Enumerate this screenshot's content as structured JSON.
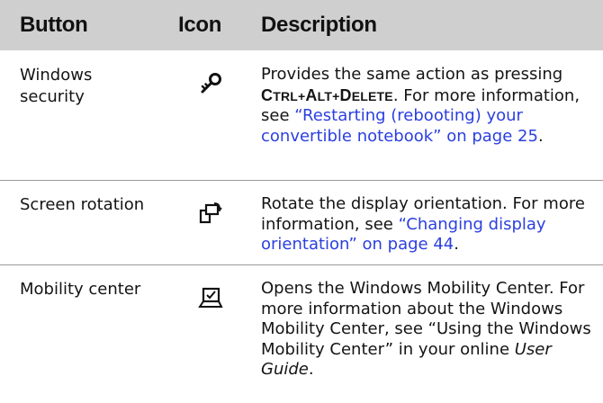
{
  "headers": {
    "button": "Button",
    "icon": "Icon",
    "description": "Description"
  },
  "rows": [
    {
      "button": "Windows security",
      "icon": "key-icon",
      "desc": {
        "pre": "Provides the same action as pressing ",
        "keys": [
          "Ctrl",
          "+",
          "Alt",
          "+",
          "Delete"
        ],
        "mid": ". For more information, see ",
        "link": "“Restarting (rebooting) your convertible notebook” on page 25",
        "post": "."
      }
    },
    {
      "button": "Screen rotation",
      "icon": "screen-rotation-icon",
      "desc": {
        "pre": "Rotate the display orientation. For more information, see ",
        "link": "“Changing display orientation” on page 44",
        "post": "."
      }
    },
    {
      "button": "Mobility center",
      "icon": "mobility-center-icon",
      "desc": {
        "pre": "Opens the Windows Mobility Center. For more information about the Windows Mobility Center, see “Using the Windows Mobility Center” in your online ",
        "em": "User Guide",
        "post": "."
      }
    }
  ],
  "colors": {
    "header_bg": "#cfcfcf",
    "link": "#2b3fe0",
    "text": "#141414"
  }
}
